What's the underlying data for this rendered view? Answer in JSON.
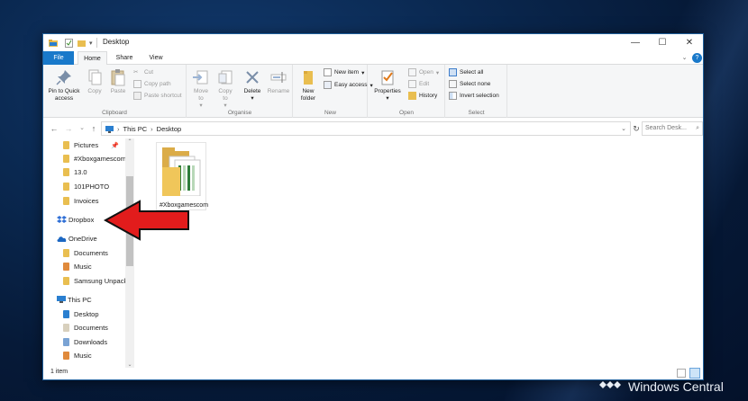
{
  "window": {
    "title": "Desktop"
  },
  "tabs": [
    "File",
    "Home",
    "Share",
    "View"
  ],
  "ribbon": {
    "clipboard": {
      "label": "Clipboard",
      "pin": "Pin to Quick access",
      "copy": "Copy",
      "paste": "Paste",
      "cut": "Cut",
      "copy_path": "Copy path",
      "paste_shortcut": "Paste shortcut"
    },
    "organise": {
      "label": "Organise",
      "move_to": "Move to",
      "copy_to": "Copy to",
      "delete": "Delete",
      "rename": "Rename"
    },
    "new": {
      "label": "New",
      "new_folder": "New folder",
      "new_item": "New item",
      "easy_access": "Easy access"
    },
    "open": {
      "label": "Open",
      "properties": "Properties",
      "open": "Open",
      "edit": "Edit",
      "history": "History"
    },
    "select": {
      "label": "Select",
      "select_all": "Select all",
      "select_none": "Select none",
      "invert": "Invert selection"
    }
  },
  "address": {
    "root": "This PC",
    "current": "Desktop",
    "search_placeholder": "Search Desk..."
  },
  "nav": {
    "quick": [
      "Pictures",
      "#Xboxgamescom",
      "13.0",
      "101PHOTO",
      "Invoices"
    ],
    "dropbox": "Dropbox",
    "onedrive": "OneDrive",
    "onedrive_items": [
      "Documents",
      "Music",
      "Samsung Unpack"
    ],
    "thispc": "This PC",
    "thispc_items": [
      "Desktop",
      "Documents",
      "Downloads",
      "Music"
    ]
  },
  "files": [
    {
      "name": "#Xboxgamescom"
    }
  ],
  "status": {
    "count": "1 item"
  },
  "watermark": "Windows Central",
  "colors": {
    "accent": "#1979ca",
    "arrow": "#e21c1c",
    "folder": "#e9be50"
  }
}
